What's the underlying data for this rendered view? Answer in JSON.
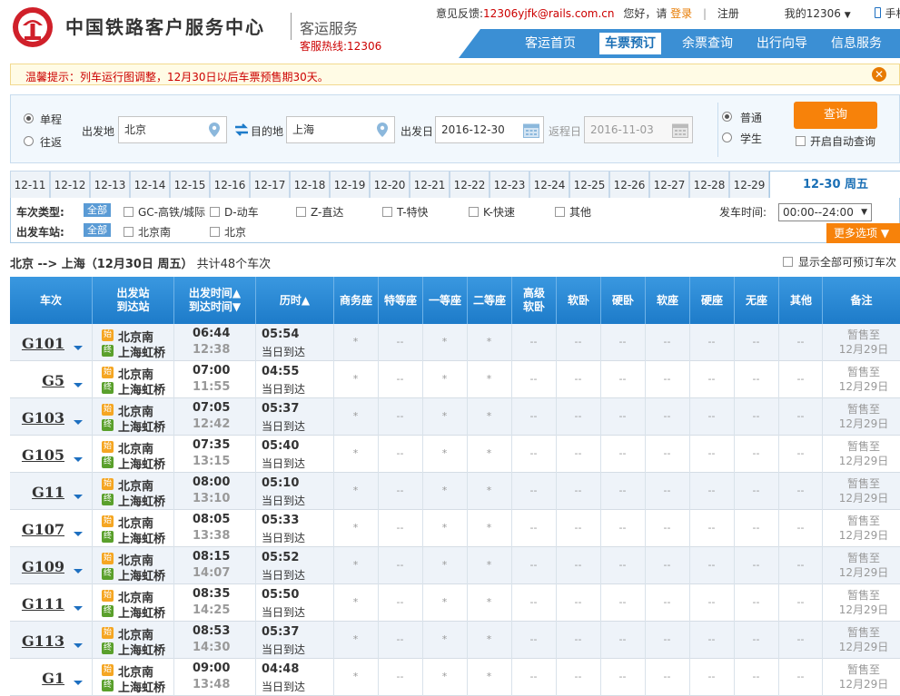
{
  "header": {
    "logo_text": "中国铁路客户服务中心",
    "logo_sub": "客运服务",
    "hotline": "客服热线:12306",
    "feedback_label": "意见反馈:",
    "feedback_email": "12306yjfk@rails.com.cn",
    "greeting": "您好，请",
    "login": "登录",
    "divider": "|",
    "register": "注册",
    "my12306": "我的12306",
    "mobile": "手机版"
  },
  "nav": [
    "客运首页",
    "车票预订",
    "余票查询",
    "出行向导",
    "信息服务"
  ],
  "nav_active": 1,
  "notice": {
    "text": "温馨提示：列车运行图调整，12月30日以后车票预售期30天。",
    "close": "✕"
  },
  "search": {
    "trip_one": "单程",
    "trip_round": "往返",
    "from_label": "出发地",
    "from_value": "北京",
    "swap": "⇄",
    "to_label": "目的地",
    "to_value": "上海",
    "date_label": "出发日",
    "date_value": "2016-12-30",
    "return_label": "返程日",
    "return_value": "2016-11-03",
    "type_normal": "普通",
    "type_student": "学生",
    "query_btn": "查询",
    "auto_query": "开启自动查询"
  },
  "dates": [
    "12-11",
    "12-12",
    "12-13",
    "12-14",
    "12-15",
    "12-16",
    "12-17",
    "12-18",
    "12-19",
    "12-20",
    "12-21",
    "12-22",
    "12-23",
    "12-24",
    "12-25",
    "12-26",
    "12-27",
    "12-28",
    "12-29",
    "12-30 周五"
  ],
  "dates_active": 19,
  "filters": {
    "type_label": "车次类型:",
    "all": "全部",
    "types": [
      "GC-高铁/城际",
      "D-动车",
      "Z-直达",
      "T-特快",
      "K-快速",
      "其他"
    ],
    "station_label": "出发车站:",
    "stations": [
      "北京南",
      "北京"
    ],
    "time_label": "发车时间:",
    "time_value": "00:00--24:00",
    "more": "更多选项 ▼"
  },
  "summary": {
    "route": "北京 --> 上海（12月30日  周五）",
    "count": "共计48个车次",
    "show_all": "显示全部可预订车次"
  },
  "columns": {
    "train": "车次",
    "station_1": "出发站",
    "station_2": "到达站",
    "time_1": "出发时间▲",
    "time_2": "到达时间▼",
    "duration": "历时▲",
    "seat_types": [
      "商务座",
      "特等座",
      "一等座",
      "二等座",
      "高级\n软卧",
      "软卧",
      "硬卧",
      "软座",
      "硬座",
      "无座",
      "其他"
    ],
    "remark": "备注"
  },
  "badges": {
    "start": "始",
    "end": "终"
  },
  "trains": [
    {
      "no": "G101",
      "from": "北京南",
      "to": "上海虹桥",
      "dep": "06:44",
      "arr": "12:38",
      "dur": "05:54",
      "arrive": "当日到达",
      "seats": [
        "*",
        "--",
        "*",
        "*",
        "--",
        "--",
        "--",
        "--",
        "--",
        "--",
        "--"
      ],
      "remark1": "暂售至",
      "remark2": "12月29日"
    },
    {
      "no": "G5",
      "from": "北京南",
      "to": "上海虹桥",
      "dep": "07:00",
      "arr": "11:55",
      "dur": "04:55",
      "arrive": "当日到达",
      "seats": [
        "*",
        "--",
        "*",
        "*",
        "--",
        "--",
        "--",
        "--",
        "--",
        "--",
        "--"
      ],
      "remark1": "暂售至",
      "remark2": "12月29日"
    },
    {
      "no": "G103",
      "from": "北京南",
      "to": "上海虹桥",
      "dep": "07:05",
      "arr": "12:42",
      "dur": "05:37",
      "arrive": "当日到达",
      "seats": [
        "*",
        "--",
        "*",
        "*",
        "--",
        "--",
        "--",
        "--",
        "--",
        "--",
        "--"
      ],
      "remark1": "暂售至",
      "remark2": "12月29日"
    },
    {
      "no": "G105",
      "from": "北京南",
      "to": "上海虹桥",
      "dep": "07:35",
      "arr": "13:15",
      "dur": "05:40",
      "arrive": "当日到达",
      "seats": [
        "*",
        "--",
        "*",
        "*",
        "--",
        "--",
        "--",
        "--",
        "--",
        "--",
        "--"
      ],
      "remark1": "暂售至",
      "remark2": "12月29日"
    },
    {
      "no": "G11",
      "from": "北京南",
      "to": "上海虹桥",
      "dep": "08:00",
      "arr": "13:10",
      "dur": "05:10",
      "arrive": "当日到达",
      "seats": [
        "*",
        "--",
        "*",
        "*",
        "--",
        "--",
        "--",
        "--",
        "--",
        "--",
        "--"
      ],
      "remark1": "暂售至",
      "remark2": "12月29日"
    },
    {
      "no": "G107",
      "from": "北京南",
      "to": "上海虹桥",
      "dep": "08:05",
      "arr": "13:38",
      "dur": "05:33",
      "arrive": "当日到达",
      "seats": [
        "*",
        "--",
        "*",
        "*",
        "--",
        "--",
        "--",
        "--",
        "--",
        "--",
        "--"
      ],
      "remark1": "暂售至",
      "remark2": "12月29日"
    },
    {
      "no": "G109",
      "from": "北京南",
      "to": "上海虹桥",
      "dep": "08:15",
      "arr": "14:07",
      "dur": "05:52",
      "arrive": "当日到达",
      "seats": [
        "*",
        "--",
        "*",
        "*",
        "--",
        "--",
        "--",
        "--",
        "--",
        "--",
        "--"
      ],
      "remark1": "暂售至",
      "remark2": "12月29日"
    },
    {
      "no": "G111",
      "from": "北京南",
      "to": "上海虹桥",
      "dep": "08:35",
      "arr": "14:25",
      "dur": "05:50",
      "arrive": "当日到达",
      "seats": [
        "*",
        "--",
        "*",
        "*",
        "--",
        "--",
        "--",
        "--",
        "--",
        "--",
        "--"
      ],
      "remark1": "暂售至",
      "remark2": "12月29日"
    },
    {
      "no": "G113",
      "from": "北京南",
      "to": "上海虹桥",
      "dep": "08:53",
      "arr": "14:30",
      "dur": "05:37",
      "arrive": "当日到达",
      "seats": [
        "*",
        "--",
        "*",
        "*",
        "--",
        "--",
        "--",
        "--",
        "--",
        "--",
        "--"
      ],
      "remark1": "暂售至",
      "remark2": "12月29日"
    },
    {
      "no": "G1",
      "from": "北京南",
      "to": "上海虹桥",
      "dep": "09:00",
      "arr": "13:48",
      "dur": "04:48",
      "arrive": "当日到达",
      "seats": [
        "*",
        "--",
        "*",
        "*",
        "--",
        "--",
        "--",
        "--",
        "--",
        "--",
        "--"
      ],
      "remark1": "暂售至",
      "remark2": "12月29日"
    }
  ]
}
